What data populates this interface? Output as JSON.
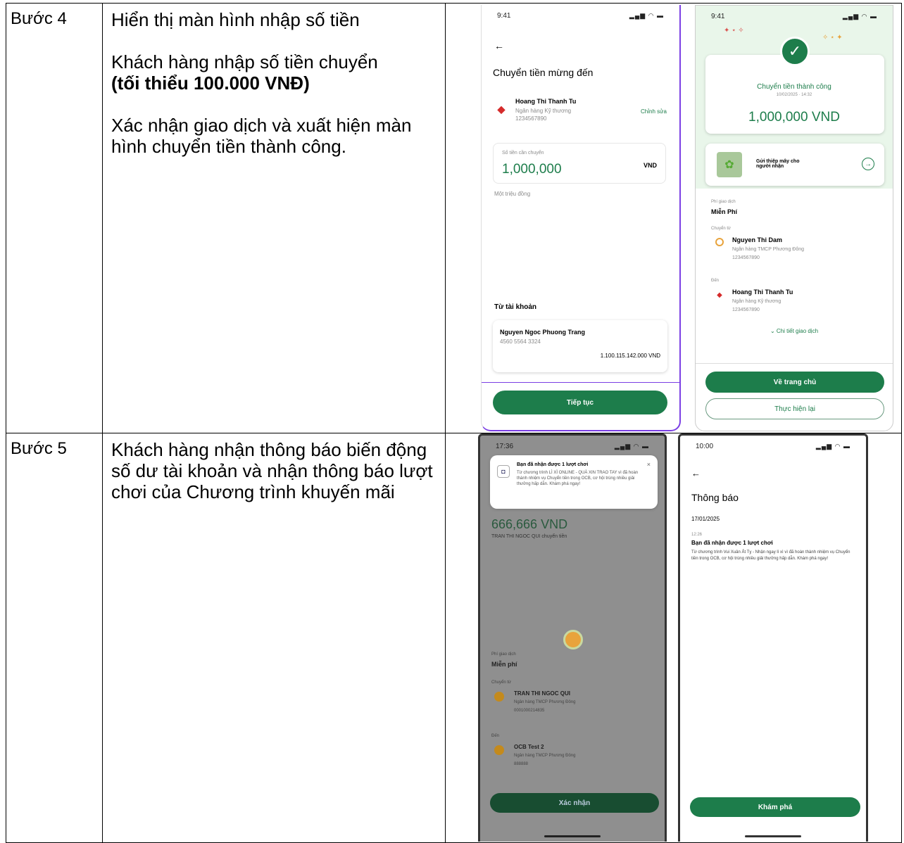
{
  "rows": [
    {
      "step": "Bước 4",
      "paragraphs": [
        {
          "text": "Hiển thị màn hình nhập số tiền"
        },
        {
          "text": "Khách hàng nhập số tiền chuyển",
          "bold": "(tối thiểu 100.000 VNĐ)"
        },
        {
          "text": "Xác nhận giao dịch và xuất hiện màn hình chuyển tiền thành công."
        }
      ]
    },
    {
      "step": "Bước 5",
      "paragraphs": [
        {
          "text": "Khách hàng nhận thông báo biến động số dư tài khoản và nhận thông báo lượt chơi của Chương trình khuyến mãi"
        }
      ]
    }
  ],
  "screen_input": {
    "time": "9:41",
    "back": "←",
    "title": "Chuyển tiền mừng đến",
    "recipient_name": "Hoang Thi Thanh Tu",
    "recipient_bank": "Ngân hàng Kỹ thương",
    "recipient_account": "1234567890",
    "edit_label": "Chỉnh sửa",
    "amount_label": "Số tiền cần chuyển",
    "amount": "1,000,000",
    "currency": "VND",
    "amount_words": "Một triệu đồng",
    "from_label": "Từ tài khoản",
    "from_name": "Nguyen Ngoc Phuong Trang",
    "from_account": "4560 5564 3324",
    "from_balance": "1.100.115.142.000 VND",
    "continue_button": "Tiếp tục"
  },
  "screen_success": {
    "time": "9:41",
    "title": "Chuyển tiền thành công",
    "datetime": "10/02/2025 · 14:32",
    "amount": "1,000,000 VND",
    "card_label": "Gửi thiệp mây cho người nhận",
    "fee_label": "Phí giao dịch",
    "fee_value": "Miễn Phí",
    "from_label": "Chuyển từ",
    "from_name": "Nguyen Thi Dam",
    "from_bank": "Ngân hàng TMCP Phương Đông",
    "from_account": "1234567890",
    "to_label": "Đến",
    "to_name": "Hoang Thi Thanh Tu",
    "to_bank": "Ngân hàng Kỹ thương",
    "to_account": "1234567890",
    "details_link": "Chi tiết giao dịch",
    "home_button": "Về trang chủ",
    "redo_button": "Thực hiện lại"
  },
  "screen_notify": {
    "time": "17:36",
    "notif_title": "Bạn đã nhận được 1 lượt chơi",
    "notif_body": "Từ chương trình LÌ XÌ ONLINE - QUÀ XIN TRAO TAY vì đã hoàn thành nhiệm vụ Chuyển tiền trong OCB, cơ hội trúng nhiều giải thưởng hấp dẫn. Khám phá ngay!",
    "amount": "666,666 VND",
    "sender_line": "TRAN THI NGOC QUI chuyển tiền",
    "fee_label": "Phí giao dịch",
    "fee_value": "Miễn phí",
    "from_label": "Chuyển từ",
    "from_name": "TRAN THI NGOC QUI",
    "from_bank": "Ngân hàng TMCP Phương Đông",
    "from_account": "0001000214835",
    "to_label": "Đến",
    "to_name": "OCB Test 2",
    "to_bank": "Ngân hàng TMCP Phương Đông",
    "to_account": "888888",
    "confirm_button": "Xác nhận"
  },
  "screen_inbox": {
    "time": "10:00",
    "back": "←",
    "title": "Thông báo",
    "date": "17/01/2025",
    "item_time": "12:26",
    "item_title": "Bạn đã nhận được 1 lượt chơi",
    "item_body": "Từ chương trình Vui Xuân Ất Tỵ - Nhận ngay lì xì vì đã hoàn thành nhiệm vụ Chuyển tiền trong OCB, cơ hội trúng nhiều giải thưởng hấp dẫn. Khám phá ngay!",
    "explore_button": "Khám phá"
  },
  "colors": {
    "accent": "#1d7d4b",
    "purple_border": "#7b3fe4",
    "overlay": "#8f8f8f"
  }
}
